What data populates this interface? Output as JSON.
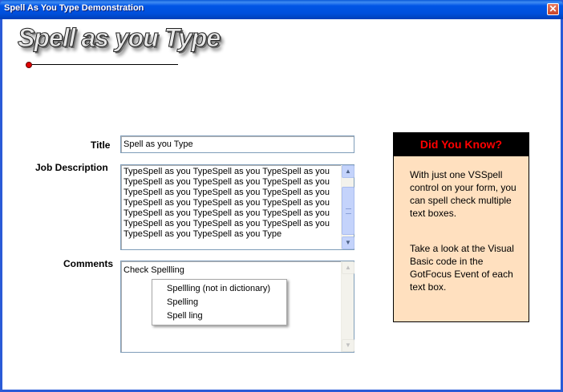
{
  "window": {
    "title": "Spell As You Type Demonstration",
    "close_glyph": "✕"
  },
  "logo": {
    "text": "Spell as you Type"
  },
  "form": {
    "title_label": "Title",
    "title_value": "Spell as you Type",
    "job_label": "Job Description",
    "job_lines": [
      "TypeSpell as you TypeSpell as you TypeSpell as you",
      "TypeSpell as you TypeSpell as you TypeSpell as you",
      "TypeSpell as you TypeSpell as you TypeSpell as you",
      "TypeSpell as you TypeSpell as you TypeSpell as you",
      "TypeSpell as you TypeSpell as you TypeSpell as you",
      "TypeSpell as you TypeSpell as you TypeSpell as you",
      "TypeSpell as you TypeSpell as you Type"
    ],
    "comments_label": "Comments",
    "comments_value": "Check Spellling"
  },
  "suggestion_menu": {
    "items": [
      "Spellling (not in dictionary)",
      "Spelling",
      "Spell ling"
    ]
  },
  "info_box": {
    "heading": "Did You Know?",
    "para1": "With just one VSSpell control on your form, you can spell check multiple text boxes.",
    "para2": "Take a look at the Visual Basic code in the GotFocus Event of each text box."
  },
  "colors": {
    "titlebar": "#0055e5",
    "info_bg": "#ffe0bf",
    "info_heading": "#ff0000",
    "logo_dot": "#e00000"
  },
  "icons": {
    "scroll_up": "up-arrow-icon",
    "scroll_down": "down-arrow-icon"
  }
}
